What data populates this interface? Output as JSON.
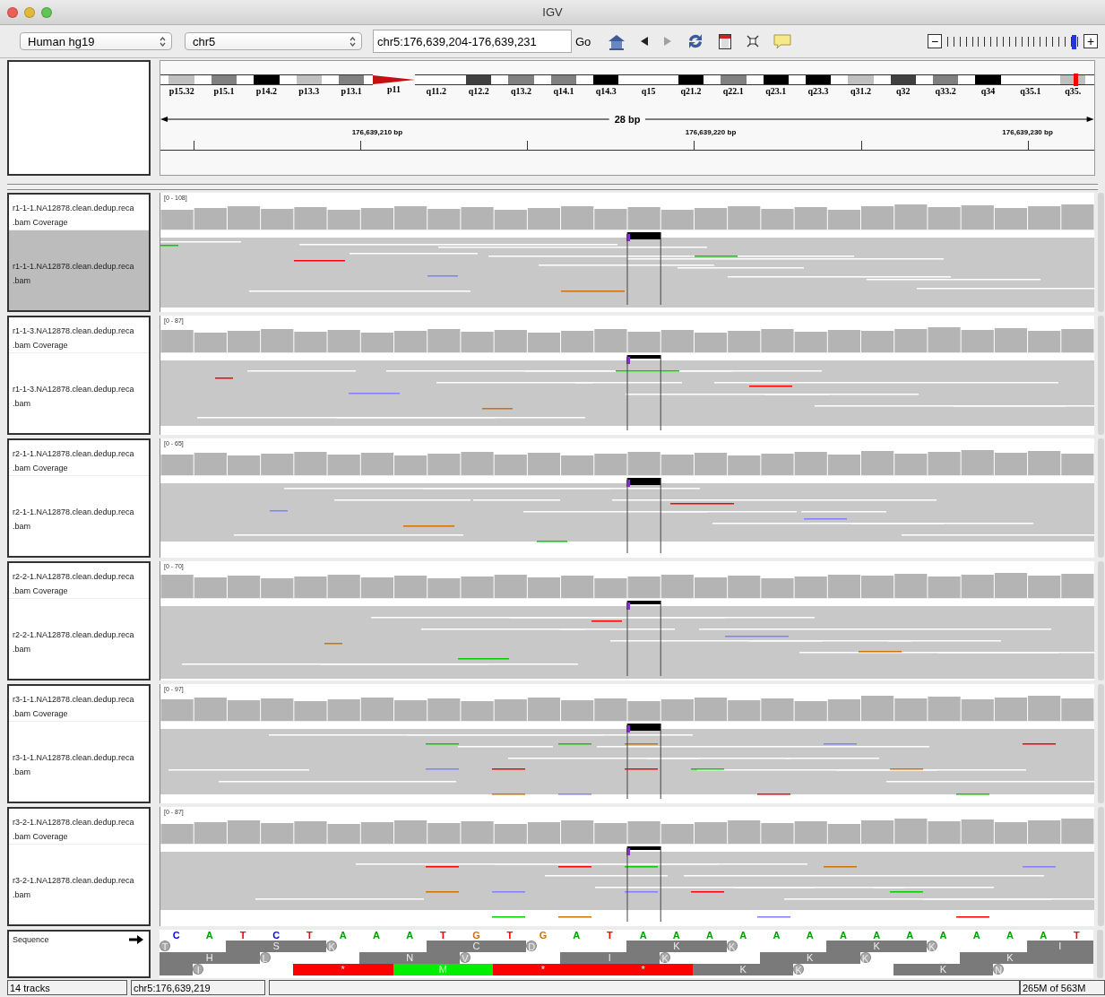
{
  "window": {
    "title": "IGV"
  },
  "toolbar": {
    "genome": "Human hg19",
    "chromosome": "chr5",
    "locus": "chr5:176,639,204-176,639,231",
    "go": "Go",
    "home": {
      "kind": "home"
    },
    "navigation": [
      {
        "kind": "back",
        "disabled": false
      },
      {
        "kind": "forward",
        "disabled": true
      }
    ],
    "tools": [
      {
        "kind": "refresh"
      },
      {
        "kind": "region"
      },
      {
        "kind": "fit"
      },
      {
        "kind": "popup"
      }
    ],
    "zoom": {
      "minus": "−",
      "plus": "+",
      "level": 0.96
    }
  },
  "ideogram": {
    "bands": [
      {
        "label": "p15.32",
        "kind": "gpos25",
        "current": false
      },
      {
        "label": "p15.1",
        "kind": "gpos50",
        "current": false
      },
      {
        "label": "p14.2",
        "kind": "gpos100",
        "current": false
      },
      {
        "label": "p13.3",
        "kind": "gpos25",
        "current": false
      },
      {
        "label": "p13.1",
        "kind": "gpos50",
        "current": false
      },
      {
        "label": "p11",
        "kind": "acen",
        "current": false
      },
      {
        "label": "q11.2",
        "kind": "gneg",
        "current": false
      },
      {
        "label": "q12.2",
        "kind": "gpos75",
        "current": false
      },
      {
        "label": "q13.2",
        "kind": "gpos50",
        "current": false
      },
      {
        "label": "q14.1",
        "kind": "gpos50",
        "current": false
      },
      {
        "label": "q14.3",
        "kind": "gpos100",
        "current": false
      },
      {
        "label": "q15",
        "kind": "gneg",
        "current": false
      },
      {
        "label": "q21.2",
        "kind": "gpos100",
        "current": false
      },
      {
        "label": "q22.1",
        "kind": "gpos50",
        "current": false
      },
      {
        "label": "q23.1",
        "kind": "gpos100",
        "current": false
      },
      {
        "label": "q23.3",
        "kind": "gpos100",
        "current": false
      },
      {
        "label": "q31.2",
        "kind": "gpos25",
        "current": false
      },
      {
        "label": "q32",
        "kind": "gpos75",
        "current": false
      },
      {
        "label": "q33.2",
        "kind": "gpos50",
        "current": false
      },
      {
        "label": "q34",
        "kind": "gpos100",
        "current": false
      },
      {
        "label": "q35.1",
        "kind": "gneg",
        "current": false
      },
      {
        "label": "q35.",
        "kind": "gpos25",
        "current": true
      }
    ]
  },
  "ruler": {
    "span": "28 bp",
    "ticks": [
      {
        "label": "176,639,210 bp"
      },
      {
        "label": "176,639,220 bp"
      },
      {
        "label": "176,639,230 bp"
      }
    ]
  },
  "panels": [
    {
      "coverage": {
        "name": [
          "r1-1-1.NA12878.clean.dedup.reca",
          ".bam Coverage"
        ],
        "range": "[0 - 108]"
      },
      "alignments": {
        "name": [
          "r1-1-1.NA12878.clean.dedup.reca",
          ".bam"
        ],
        "selected": true
      }
    },
    {
      "coverage": {
        "name": [
          "r1-1-3.NA12878.clean.dedup.reca",
          ".bam Coverage"
        ],
        "range": "[0 - 87]"
      },
      "alignments": {
        "name": [
          "r1-1-3.NA12878.clean.dedup.reca",
          ".bam"
        ],
        "selected": false
      }
    },
    {
      "coverage": {
        "name": [
          "r2-1-1.NA12878.clean.dedup.reca",
          ".bam Coverage"
        ],
        "range": "[0 - 65]"
      },
      "alignments": {
        "name": [
          "r2-1-1.NA12878.clean.dedup.reca",
          ".bam"
        ],
        "selected": false
      }
    },
    {
      "coverage": {
        "name": [
          "r2-2-1.NA12878.clean.dedup.reca",
          ".bam Coverage"
        ],
        "range": "[0 - 70]"
      },
      "alignments": {
        "name": [
          "r2-2-1.NA12878.clean.dedup.reca",
          ".bam"
        ],
        "selected": false
      }
    },
    {
      "coverage": {
        "name": [
          "r3-1-1.NA12878.clean.dedup.reca",
          ".bam Coverage"
        ],
        "range": "[0 - 97]"
      },
      "alignments": {
        "name": [
          "r3-1-1.NA12878.clean.dedup.reca",
          ".bam"
        ],
        "selected": false
      }
    },
    {
      "coverage": {
        "name": [
          "r3-2-1.NA12878.clean.dedup.reca",
          ".bam Coverage"
        ],
        "range": "[0 - 87]"
      },
      "alignments": {
        "name": [
          "r3-2-1.NA12878.clean.dedup.reca",
          ".bam"
        ],
        "selected": false
      }
    }
  ],
  "sequence": {
    "name": "Sequence",
    "bases": [
      {
        "base": "C",
        "color": "#0000ff"
      },
      {
        "base": "A",
        "color": "#00a000"
      },
      {
        "base": "T",
        "color": "#ff0000"
      },
      {
        "base": "C",
        "color": "#0000ff"
      },
      {
        "base": "T",
        "color": "#ff0000"
      },
      {
        "base": "A",
        "color": "#00a000"
      },
      {
        "base": "A",
        "color": "#00a000"
      },
      {
        "base": "A",
        "color": "#00a000"
      },
      {
        "base": "T",
        "color": "#ff0000"
      },
      {
        "base": "G",
        "color": "#d17105"
      },
      {
        "base": "T",
        "color": "#ff0000"
      },
      {
        "base": "G",
        "color": "#d17105"
      },
      {
        "base": "A",
        "color": "#00a000"
      },
      {
        "base": "T",
        "color": "#ff0000"
      },
      {
        "base": "A",
        "color": "#00a000"
      },
      {
        "base": "A",
        "color": "#00a000"
      },
      {
        "base": "A",
        "color": "#00a000"
      },
      {
        "base": "A",
        "color": "#00a000"
      },
      {
        "base": "A",
        "color": "#00a000"
      },
      {
        "base": "A",
        "color": "#00a000"
      },
      {
        "base": "A",
        "color": "#00a000"
      },
      {
        "base": "A",
        "color": "#00a000"
      },
      {
        "base": "A",
        "color": "#00a000"
      },
      {
        "base": "A",
        "color": "#00a000"
      },
      {
        "base": "A",
        "color": "#00a000"
      },
      {
        "base": "A",
        "color": "#00a000"
      },
      {
        "base": "A",
        "color": "#00a000"
      },
      {
        "base": "T",
        "color": "#ff0000"
      }
    ],
    "frames": [
      [
        {
          "aa": "T",
          "kind": "amino"
        },
        {
          "aa": "S",
          "kind": "amino"
        },
        {
          "aa": "K",
          "kind": "amino"
        },
        {
          "aa": "C",
          "kind": "amino"
        },
        {
          "aa": "D",
          "kind": "amino"
        },
        {
          "aa": "K",
          "kind": "amino"
        },
        {
          "aa": "K",
          "kind": "amino"
        },
        {
          "aa": "K",
          "kind": "amino"
        },
        {
          "aa": "K",
          "kind": "amino"
        },
        {
          "aa": "I",
          "kind": "amino"
        }
      ],
      [
        {
          "aa": "H",
          "kind": "amino"
        },
        {
          "aa": "L",
          "kind": "amino"
        },
        {
          "aa": "N",
          "kind": "amino"
        },
        {
          "aa": "V",
          "kind": "amino"
        },
        {
          "aa": "I",
          "kind": "amino"
        },
        {
          "aa": "K",
          "kind": "amino"
        },
        {
          "aa": "K",
          "kind": "amino"
        },
        {
          "aa": "K",
          "kind": "amino"
        },
        {
          "aa": "K",
          "kind": "amino"
        }
      ],
      [
        {
          "aa": "I",
          "kind": "amino"
        },
        {
          "aa": "*",
          "kind": "stop"
        },
        {
          "aa": "M",
          "kind": "start"
        },
        {
          "aa": "*",
          "kind": "stop"
        },
        {
          "aa": "*",
          "kind": "stop"
        },
        {
          "aa": "K",
          "kind": "amino"
        },
        {
          "aa": "K",
          "kind": "amino"
        },
        {
          "aa": "K",
          "kind": "amino"
        },
        {
          "aa": "N",
          "kind": "amino"
        }
      ]
    ]
  },
  "status_bar": {
    "tracks": "14 tracks",
    "position": "chr5:176,639,219",
    "memory": "265M of 563M"
  }
}
